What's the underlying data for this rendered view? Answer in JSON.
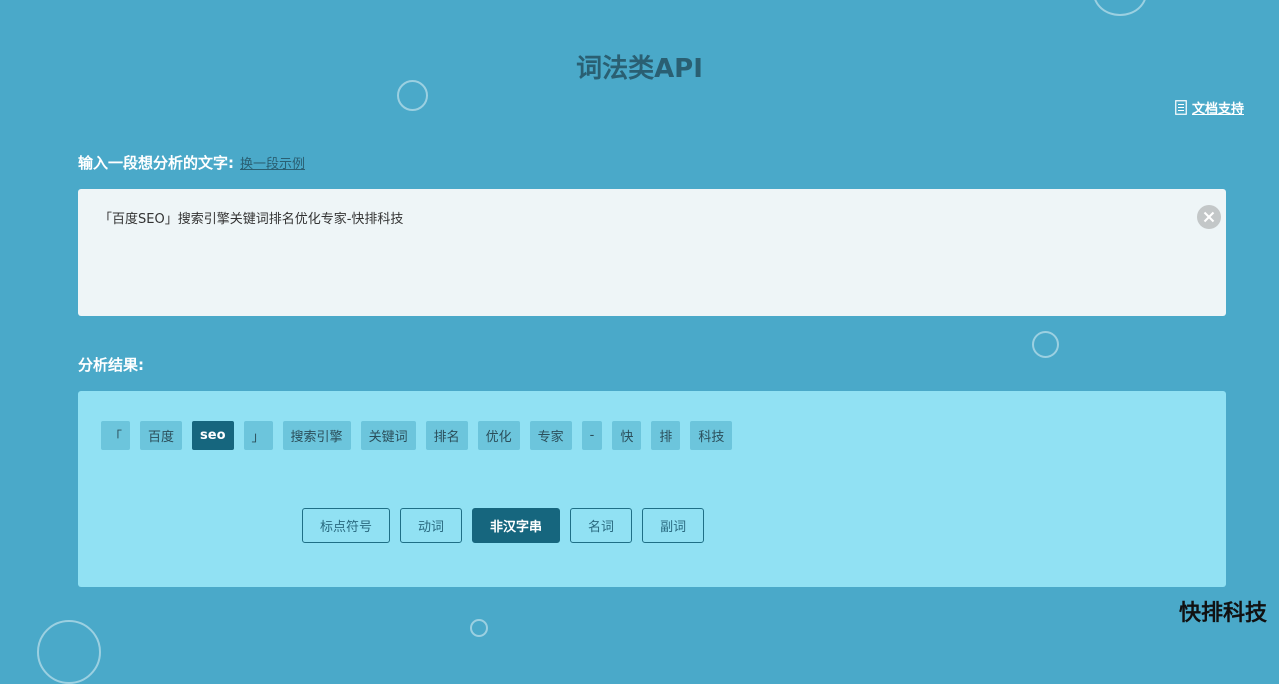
{
  "page": {
    "title": "词法类API",
    "doc_link": "文档支持"
  },
  "input": {
    "label": "输入一段想分析的文字:",
    "example_link": "换一段示例",
    "value": "「百度SEO」搜索引擎关键词排名优化专家-快排科技",
    "clear_icon": "close-icon"
  },
  "result": {
    "label": "分析结果:",
    "tokens": [
      {
        "text": "「",
        "active": false
      },
      {
        "text": "百度",
        "active": false
      },
      {
        "text": "seo",
        "active": true
      },
      {
        "text": "」",
        "active": false
      },
      {
        "text": "搜索引擎",
        "active": false
      },
      {
        "text": "关键词",
        "active": false
      },
      {
        "text": "排名",
        "active": false
      },
      {
        "text": "优化",
        "active": false
      },
      {
        "text": "专家",
        "active": false
      },
      {
        "text": "-",
        "active": false
      },
      {
        "text": "快",
        "active": false
      },
      {
        "text": "排",
        "active": false
      },
      {
        "text": "科技",
        "active": false
      }
    ],
    "categories": [
      {
        "label": "标点符号",
        "active": false
      },
      {
        "label": "动词",
        "active": false
      },
      {
        "label": "非汉字串",
        "active": true
      },
      {
        "label": "名词",
        "active": false
      },
      {
        "label": "副词",
        "active": false
      }
    ]
  },
  "watermark": "快排科技",
  "colors": {
    "background": "#4aa9c9",
    "title": "#2a5f72",
    "panel": "#91e1f3",
    "token": "#6cc5dc",
    "active": "#16667e"
  }
}
